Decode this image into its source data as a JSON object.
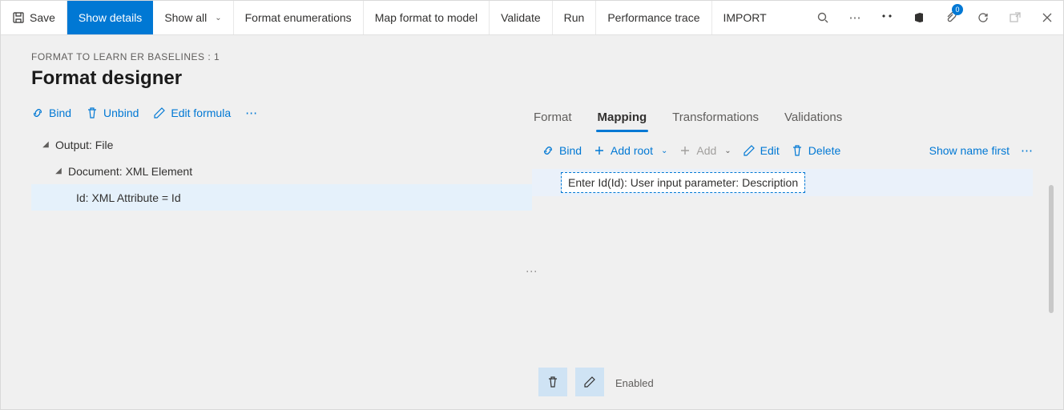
{
  "toolbar": {
    "save_label": "Save",
    "show_details_label": "Show details",
    "show_all_label": "Show all",
    "format_enum_label": "Format enumerations",
    "map_format_label": "Map format to model",
    "validate_label": "Validate",
    "run_label": "Run",
    "perf_trace_label": "Performance trace",
    "import_label": "IMPORT",
    "badge_count": "0"
  },
  "breadcrumb": "FORMAT TO LEARN ER BASELINES : 1",
  "page_title": "Format designer",
  "left_actions": {
    "bind_label": "Bind",
    "unbind_label": "Unbind",
    "edit_formula_label": "Edit formula"
  },
  "tree": {
    "row0": "Output: File",
    "row1": "Document: XML Element",
    "row2": "Id: XML Attribute = Id"
  },
  "tabs": {
    "format": "Format",
    "mapping": "Mapping",
    "transformations": "Transformations",
    "validations": "Validations"
  },
  "right_actions": {
    "bind_label": "Bind",
    "add_root_label": "Add root",
    "add_label": "Add",
    "edit_label": "Edit",
    "delete_label": "Delete",
    "show_name_first_label": "Show name first"
  },
  "right_row_text": "Enter Id(Id): User input parameter: Description",
  "footer": {
    "enabled_label": "Enabled"
  }
}
